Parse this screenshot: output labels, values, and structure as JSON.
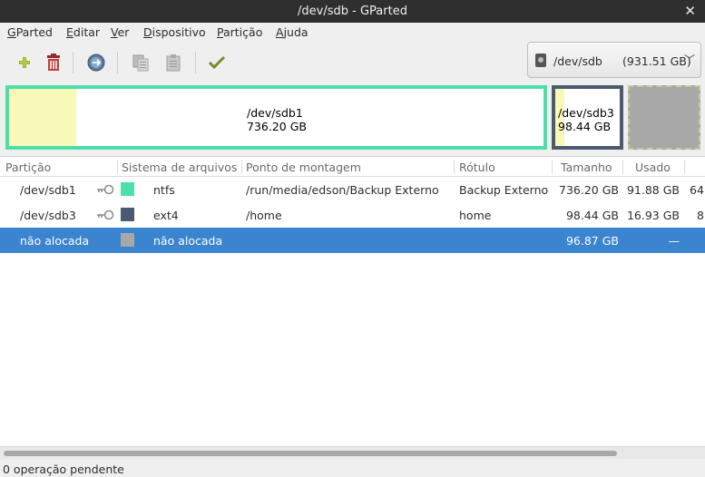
{
  "window": {
    "title": "/dev/sdb - GParted"
  },
  "menu": [
    {
      "label_first": "G",
      "label_rest": "Parted"
    },
    {
      "label_first": "E",
      "label_rest": "ditar"
    },
    {
      "label_first": "V",
      "label_rest": "er"
    },
    {
      "label_first": "D",
      "label_rest": "ispositivo"
    },
    {
      "label_first": "P",
      "label_rest": "artição"
    },
    {
      "label_first": "A",
      "label_rest": "juda"
    }
  ],
  "toolbar": {
    "icons": [
      "new-partition-icon",
      "delete-icon",
      "resize-move-icon",
      "copy-icon",
      "paste-icon",
      "apply-icon"
    ]
  },
  "device": {
    "name": "/dev/sdb",
    "size": "(931.51 GB)"
  },
  "disk_map": {
    "sdb1": {
      "name": "/dev/sdb1",
      "size": "736.20 GB",
      "color": "#4ce0a8"
    },
    "sdb3": {
      "name": "/dev/sdb3",
      "size": "98.44 GB",
      "color": "#4a5a72"
    },
    "unallocated": {
      "color": "#a8a8a8"
    }
  },
  "table": {
    "headers": {
      "partition": "Partição",
      "filesystem": "Sistema de arquivos",
      "mountpoint": "Ponto de montagem",
      "label": "Rótulo",
      "size": "Tamanho",
      "used": "Usado"
    },
    "rows": [
      {
        "partition": "/dev/sdb1",
        "fs_color": "#4ce0a8",
        "filesystem": "ntfs",
        "mountpoint": "/run/media/edson/Backup Externo",
        "label": "Backup Externo",
        "size": "736.20 GB",
        "used": "91.88 GB",
        "unused": "64"
      },
      {
        "partition": "/dev/sdb3",
        "fs_color": "#4a5a72",
        "filesystem": "ext4",
        "mountpoint": "/home",
        "label": "home",
        "size": "98.44 GB",
        "used": "16.93 GB",
        "unused": "8"
      },
      {
        "partition": "não alocada",
        "fs_color": "#a8a8a8",
        "filesystem": "não alocada",
        "mountpoint": "",
        "label": "",
        "size": "96.87 GB",
        "used": "—",
        "unused": ""
      }
    ]
  },
  "status": {
    "text": "0 operação pendente"
  }
}
